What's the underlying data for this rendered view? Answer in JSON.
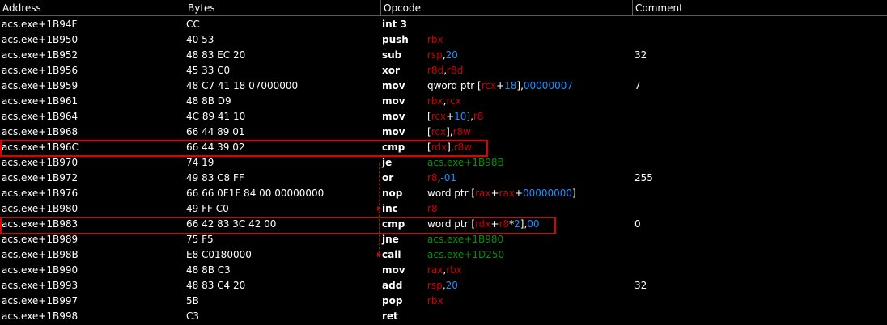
{
  "columns": {
    "address": "Address",
    "bytes": "Bytes",
    "opcode": "Opcode",
    "comment": "Comment"
  },
  "colors": {
    "register": "#cc0000",
    "number": "#1e90ff",
    "address_ref": "#0a8f0a",
    "highlight_box": "#e00000"
  },
  "rows": [
    {
      "address": "acs.exe+1B94F",
      "bytes": "CC",
      "mnemonic": "int 3",
      "operands": [],
      "comment": ""
    },
    {
      "address": "acs.exe+1B950",
      "bytes": "40 53",
      "mnemonic": "push",
      "operands": [
        {
          "t": "rbx",
          "k": "reg"
        }
      ],
      "comment": ""
    },
    {
      "address": "acs.exe+1B952",
      "bytes": "48 83 EC 20",
      "mnemonic": "sub",
      "operands": [
        {
          "t": "rsp",
          "k": "reg"
        },
        {
          "t": ",",
          "k": "text"
        },
        {
          "t": "20",
          "k": "num"
        }
      ],
      "comment": "32"
    },
    {
      "address": "acs.exe+1B956",
      "bytes": "45 33 C0",
      "mnemonic": "xor",
      "operands": [
        {
          "t": "r8d",
          "k": "reg"
        },
        {
          "t": ",",
          "k": "text"
        },
        {
          "t": "r8d",
          "k": "reg"
        }
      ],
      "comment": ""
    },
    {
      "address": "acs.exe+1B959",
      "bytes": "48 C7 41 18 07000000",
      "mnemonic": "mov",
      "operands": [
        {
          "t": "qword ptr [",
          "k": "text"
        },
        {
          "t": "rcx",
          "k": "reg"
        },
        {
          "t": "+",
          "k": "text"
        },
        {
          "t": "18",
          "k": "num"
        },
        {
          "t": "],",
          "k": "text"
        },
        {
          "t": "00000007",
          "k": "num"
        }
      ],
      "comment": "7"
    },
    {
      "address": "acs.exe+1B961",
      "bytes": "48 8B D9",
      "mnemonic": "mov",
      "operands": [
        {
          "t": "rbx",
          "k": "reg"
        },
        {
          "t": ",",
          "k": "text"
        },
        {
          "t": "rcx",
          "k": "reg"
        }
      ],
      "comment": ""
    },
    {
      "address": "acs.exe+1B964",
      "bytes": "4C 89 41 10",
      "mnemonic": "mov",
      "operands": [
        {
          "t": "[",
          "k": "text"
        },
        {
          "t": "rcx",
          "k": "reg"
        },
        {
          "t": "+",
          "k": "text"
        },
        {
          "t": "10",
          "k": "num"
        },
        {
          "t": "],",
          "k": "text"
        },
        {
          "t": "r8",
          "k": "reg"
        }
      ],
      "comment": ""
    },
    {
      "address": "acs.exe+1B968",
      "bytes": "66 44 89 01",
      "mnemonic": "mov",
      "operands": [
        {
          "t": "[",
          "k": "text"
        },
        {
          "t": "rcx",
          "k": "reg"
        },
        {
          "t": "],",
          "k": "text"
        },
        {
          "t": "r8w",
          "k": "reg"
        }
      ],
      "comment": ""
    },
    {
      "address": "acs.exe+1B96C",
      "bytes": "66 44 39 02",
      "mnemonic": "cmp",
      "operands": [
        {
          "t": "[",
          "k": "text"
        },
        {
          "t": "rdx",
          "k": "reg"
        },
        {
          "t": "],",
          "k": "text"
        },
        {
          "t": "r8w",
          "k": "reg"
        }
      ],
      "comment": ""
    },
    {
      "address": "acs.exe+1B970",
      "bytes": "74 19",
      "mnemonic": "je",
      "operands": [
        {
          "t": "acs.exe+1B98B",
          "k": "addr"
        }
      ],
      "comment": ""
    },
    {
      "address": "acs.exe+1B972",
      "bytes": "49 83 C8 FF",
      "mnemonic": "or",
      "operands": [
        {
          "t": "r8",
          "k": "reg"
        },
        {
          "t": ",",
          "k": "text"
        },
        {
          "t": "-01",
          "k": "num"
        }
      ],
      "comment": "255"
    },
    {
      "address": "acs.exe+1B976",
      "bytes": "66 66 0F1F 84 00 00000000",
      "mnemonic": "nop",
      "operands": [
        {
          "t": "word ptr [",
          "k": "text"
        },
        {
          "t": "rax",
          "k": "reg"
        },
        {
          "t": "+",
          "k": "text"
        },
        {
          "t": "rax",
          "k": "reg"
        },
        {
          "t": "+",
          "k": "text"
        },
        {
          "t": "00000000",
          "k": "num"
        },
        {
          "t": "]",
          "k": "text"
        }
      ],
      "comment": ""
    },
    {
      "address": "acs.exe+1B980",
      "bytes": "49 FF C0",
      "mnemonic": "inc",
      "operands": [
        {
          "t": "r8",
          "k": "reg"
        }
      ],
      "comment": ""
    },
    {
      "address": "acs.exe+1B983",
      "bytes": "66 42 83 3C 42  00",
      "mnemonic": "cmp",
      "operands": [
        {
          "t": "word ptr [",
          "k": "text"
        },
        {
          "t": "rdx",
          "k": "reg"
        },
        {
          "t": "+",
          "k": "text"
        },
        {
          "t": "r8",
          "k": "reg"
        },
        {
          "t": "*",
          "k": "text"
        },
        {
          "t": "2",
          "k": "num"
        },
        {
          "t": "],",
          "k": "text"
        },
        {
          "t": "00",
          "k": "num"
        }
      ],
      "comment": "0"
    },
    {
      "address": "acs.exe+1B989",
      "bytes": "75 F5",
      "mnemonic": "jne",
      "operands": [
        {
          "t": "acs.exe+1B980",
          "k": "addr"
        }
      ],
      "comment": ""
    },
    {
      "address": "acs.exe+1B98B",
      "bytes": "E8 C0180000",
      "mnemonic": "call",
      "operands": [
        {
          "t": "acs.exe+1D250",
          "k": "addr"
        }
      ],
      "comment": ""
    },
    {
      "address": "acs.exe+1B990",
      "bytes": "48 8B C3",
      "mnemonic": "mov",
      "operands": [
        {
          "t": "rax",
          "k": "reg"
        },
        {
          "t": ",",
          "k": "text"
        },
        {
          "t": "rbx",
          "k": "reg"
        }
      ],
      "comment": ""
    },
    {
      "address": "acs.exe+1B993",
      "bytes": "48 83 C4 20",
      "mnemonic": "add",
      "operands": [
        {
          "t": "rsp",
          "k": "reg"
        },
        {
          "t": ",",
          "k": "text"
        },
        {
          "t": "20",
          "k": "num"
        }
      ],
      "comment": "32"
    },
    {
      "address": "acs.exe+1B997",
      "bytes": "5B",
      "mnemonic": "pop",
      "operands": [
        {
          "t": "rbx",
          "k": "reg"
        }
      ],
      "comment": ""
    },
    {
      "address": "acs.exe+1B998",
      "bytes": "C3",
      "mnemonic": "ret",
      "operands": [],
      "comment": ""
    }
  ]
}
